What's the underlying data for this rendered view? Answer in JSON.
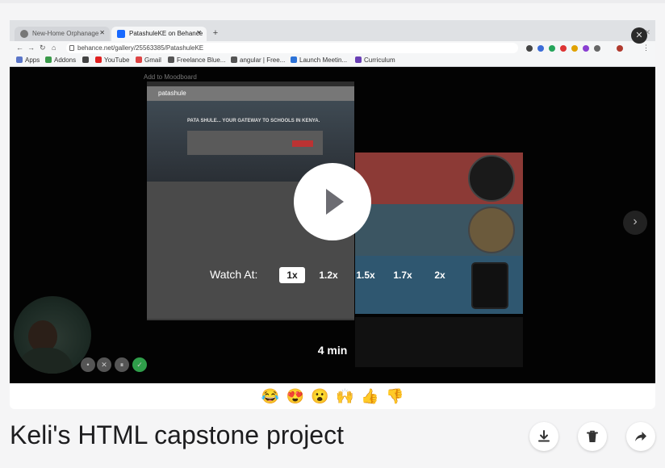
{
  "browser": {
    "tabs": [
      {
        "title": "New-Home Orphanage"
      },
      {
        "title": "PatashuleKE on Behance"
      }
    ],
    "url": "behance.net/gallery/25563385/PatashuleKE",
    "bookmarks": [
      "Apps",
      "Addons",
      "YouTube",
      "Gmail",
      "Freelance Blue...",
      "angular | Free...",
      "Launch Meetin...",
      "Curriculum"
    ]
  },
  "recording_page": {
    "moodboard_label": "Add to Moodboard",
    "site_logo": "patashule",
    "hero_text": "PATA SHULE... YOUR GATEWAY TO SCHOOLS IN KENYA."
  },
  "player": {
    "watch_at_label": "Watch At:",
    "speeds": [
      "1x",
      "1.2x",
      "1.5x",
      "1.7x",
      "2x"
    ],
    "selected_speed": "1x",
    "duration": "4 min",
    "close_icon": "close-icon",
    "next_icon": "chevron-right-icon",
    "play_icon": "play-icon"
  },
  "reactions": [
    "😂",
    "😍",
    "😮",
    "🙌",
    "👍",
    "👎"
  ],
  "video": {
    "title": "Keli's HTML capstone project"
  },
  "actions": [
    {
      "name": "download-button",
      "icon": "download-icon"
    },
    {
      "name": "delete-button",
      "icon": "trash-icon"
    },
    {
      "name": "share-button",
      "icon": "share-icon"
    }
  ]
}
